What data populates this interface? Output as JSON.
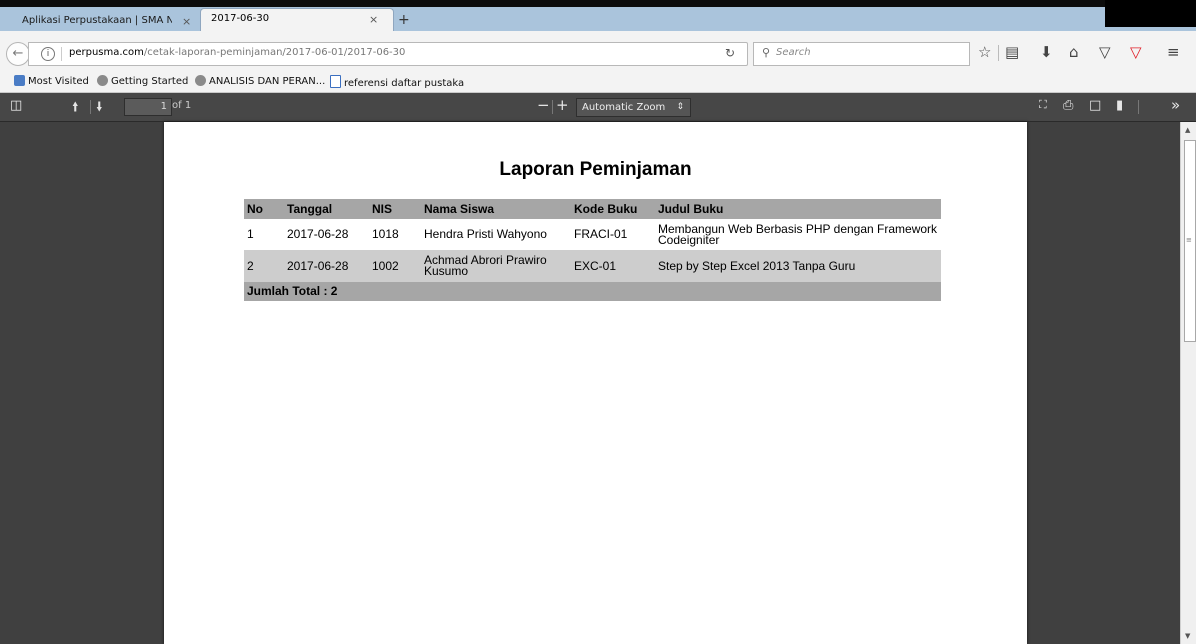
{
  "tabs": [
    {
      "title": "Aplikasi Perpustakaan | SMA Neg",
      "close": "×"
    },
    {
      "title": "2017-06-30",
      "close": "×"
    }
  ],
  "new_tab": "+",
  "navbar": {
    "url_domain": "perpusma.com",
    "url_path": "/cetak-laporan-peminjaman/2017-06-01/2017-06-30",
    "search_placeholder": "Search"
  },
  "bookmarks": [
    {
      "label": "Most Visited",
      "icon": "most-visited-icon"
    },
    {
      "label": "Getting Started",
      "icon": "globe-icon"
    },
    {
      "label": "ANALISIS DAN PERAN...",
      "icon": "globe-icon"
    },
    {
      "label": "referensi daftar pustaka",
      "icon": "document-icon"
    }
  ],
  "pdf_toolbar": {
    "page_number": "1",
    "page_count": "of 1",
    "zoom": "Automatic Zoom"
  },
  "report": {
    "title": "Laporan Peminjaman",
    "headers": [
      "No",
      "Tanggal",
      "NIS",
      "Nama Siswa",
      "Kode Buku",
      "Judul Buku"
    ],
    "rows": [
      [
        "1",
        "2017-06-28",
        "1018",
        "Hendra Pristi Wahyono",
        "FRACI-01",
        "Membangun Web Berbasis PHP dengan Framework Codeigniter"
      ],
      [
        "2",
        "2017-06-28",
        "1002",
        "Achmad Abrori Prawiro Kusumo",
        "EXC-01",
        "Step by Step Excel 2013 Tanpa Guru"
      ]
    ],
    "total": "Jumlah Total : 2"
  },
  "colors": {
    "tab_strip": "#aac4dc",
    "pdf_toolbar": "#474747",
    "viewer_bg": "#404040",
    "table_header": "#a6a6a6",
    "table_alt_row": "#cdcdcd"
  }
}
